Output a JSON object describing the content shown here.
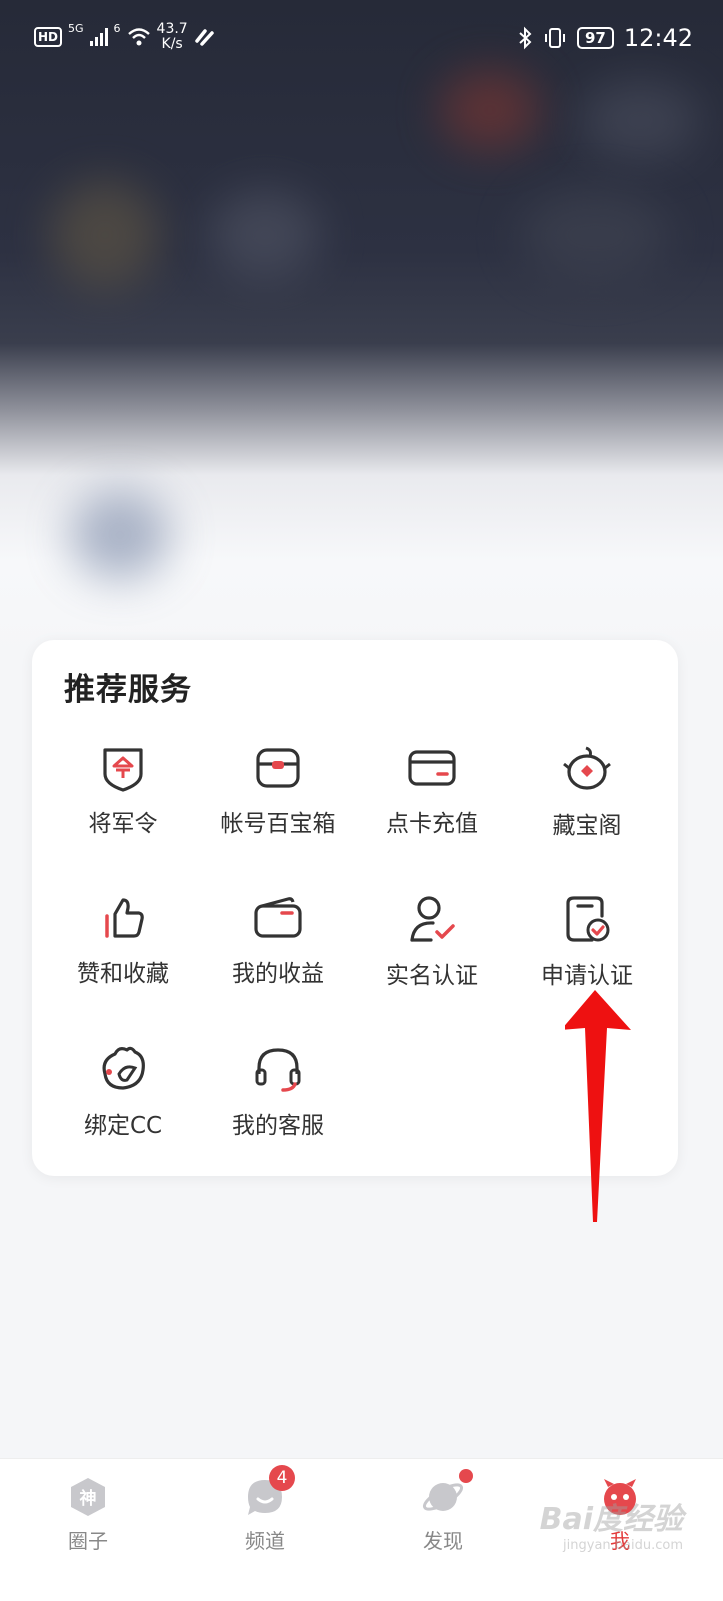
{
  "status_bar": {
    "hd": "HD",
    "network1": "5G",
    "network2": "6",
    "speed_value": "43.7",
    "speed_unit": "K/s",
    "battery": "97",
    "time": "12:42"
  },
  "services": {
    "title": "推荐服务",
    "items": [
      {
        "label": "将军令",
        "icon": "general-order-shield-icon"
      },
      {
        "label": "帐号百宝箱",
        "icon": "treasure-box-icon"
      },
      {
        "label": "点卡充值",
        "icon": "card-recharge-icon"
      },
      {
        "label": "藏宝阁",
        "icon": "treasure-pavilion-icon"
      },
      {
        "label": "赞和收藏",
        "icon": "thumbs-up-icon"
      },
      {
        "label": "我的收益",
        "icon": "wallet-icon"
      },
      {
        "label": "实名认证",
        "icon": "user-verify-icon"
      },
      {
        "label": "申请认证",
        "icon": "apply-certification-icon"
      },
      {
        "label": "绑定CC",
        "icon": "cc-bird-icon"
      },
      {
        "label": "我的客服",
        "icon": "headset-icon"
      }
    ]
  },
  "bottom_nav": {
    "items": [
      {
        "label": "圈子",
        "icon": "shen-hexagon-icon"
      },
      {
        "label": "频道",
        "icon": "channel-bubble-icon",
        "badge": "4"
      },
      {
        "label": "发现",
        "icon": "planet-icon"
      },
      {
        "label": "我",
        "icon": "profile-mascot-icon"
      }
    ],
    "active": "我"
  },
  "colors": {
    "accent": "#e5484d",
    "icon_stroke": "#333333"
  },
  "watermark": {
    "brand": "Bai度经验",
    "url": "jingyan.baidu.com"
  }
}
